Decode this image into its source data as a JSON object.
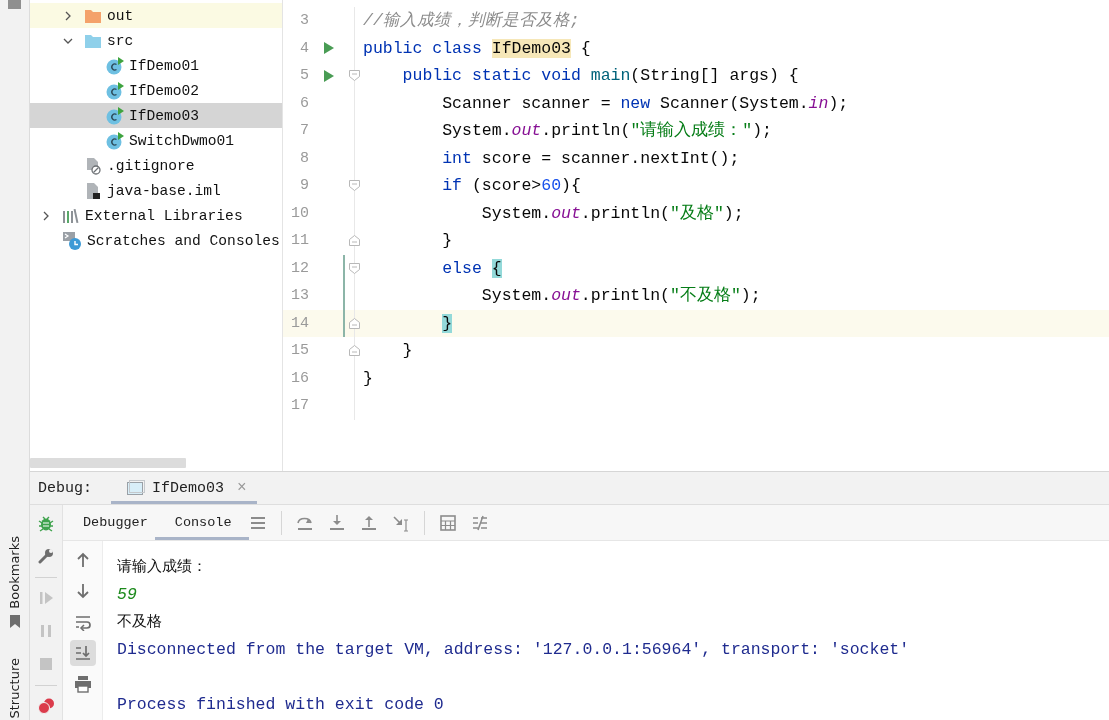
{
  "left_strip": {
    "tools": [
      {
        "label": "Bookmarks"
      },
      {
        "label": "Structure"
      }
    ]
  },
  "project_tree": {
    "items": [
      {
        "kind": "group",
        "children": [
          {
            "label": "out",
            "kind": "folder_excluded",
            "expanded": false,
            "highlighted": true,
            "selected": false
          },
          {
            "label": "src",
            "kind": "folder_source",
            "expanded": true,
            "highlighted": false,
            "selected": false,
            "children": [
              {
                "label": "IfDemo01",
                "kind": "java_class",
                "highlighted": false,
                "selected": false
              },
              {
                "label": "IfDemo02",
                "kind": "java_class",
                "highlighted": false,
                "selected": false
              },
              {
                "label": "IfDemo03",
                "kind": "java_class",
                "highlighted": false,
                "selected": true
              },
              {
                "label": "SwitchDwmo01",
                "kind": "java_class",
                "highlighted": false,
                "selected": false
              }
            ]
          },
          {
            "label": ".gitignore",
            "kind": "ignore_file",
            "highlighted": false,
            "selected": false
          },
          {
            "label": "java-base.iml",
            "kind": "module_file",
            "highlighted": false,
            "selected": false
          }
        ]
      },
      {
        "label": "External Libraries",
        "kind": "libraries",
        "expanded": false,
        "highlighted": false,
        "selected": false
      },
      {
        "label": "Scratches and Consoles",
        "kind": "scratches",
        "highlighted": false,
        "selected": false
      }
    ]
  },
  "editor": {
    "lines": [
      {
        "number": "3",
        "run": false,
        "fold_start": false,
        "fold_end": false,
        "changed": false,
        "current": false,
        "tokens": [
          {
            "kind": "comment",
            "text": "//输入成绩，判断是否及格;"
          }
        ]
      },
      {
        "number": "4",
        "run": true,
        "fold_start": false,
        "fold_end": false,
        "changed": false,
        "current": false,
        "tokens": [
          {
            "kind": "keyword",
            "text": "public class "
          },
          {
            "kind": "usage_highlight",
            "text": "IfDemo03"
          },
          {
            "kind": "text",
            "text": " {"
          }
        ]
      },
      {
        "number": "5",
        "run": true,
        "fold_start": true,
        "fold_end": false,
        "changed": false,
        "current": false,
        "tokens": [
          {
            "kind": "keyword",
            "text": "    public static void "
          },
          {
            "kind": "declaration",
            "text": "main"
          },
          {
            "kind": "text",
            "text": "(String[] args) {"
          }
        ]
      },
      {
        "number": "6",
        "run": false,
        "fold_start": false,
        "fold_end": false,
        "changed": false,
        "current": false,
        "tokens": [
          {
            "kind": "text",
            "text": "        Scanner scanner = "
          },
          {
            "kind": "keyword",
            "text": "new"
          },
          {
            "kind": "text",
            "text": " Scanner(System."
          },
          {
            "kind": "static_field",
            "text": "in"
          },
          {
            "kind": "text",
            "text": ");"
          }
        ]
      },
      {
        "number": "7",
        "run": false,
        "fold_start": false,
        "fold_end": false,
        "changed": false,
        "current": false,
        "tokens": [
          {
            "kind": "text",
            "text": "        System."
          },
          {
            "kind": "static_field",
            "text": "out"
          },
          {
            "kind": "text",
            "text": ".println("
          },
          {
            "kind": "string",
            "text": "\"请输入成绩：\""
          },
          {
            "kind": "text",
            "text": ");"
          }
        ]
      },
      {
        "number": "8",
        "run": false,
        "fold_start": false,
        "fold_end": false,
        "changed": false,
        "current": false,
        "tokens": [
          {
            "kind": "keyword",
            "text": "        int"
          },
          {
            "kind": "text",
            "text": " score = scanner.nextInt();"
          }
        ]
      },
      {
        "number": "9",
        "run": false,
        "fold_start": true,
        "fold_end": false,
        "changed": false,
        "current": false,
        "tokens": [
          {
            "kind": "keyword",
            "text": "        if"
          },
          {
            "kind": "text",
            "text": " (score>"
          },
          {
            "kind": "number",
            "text": "60"
          },
          {
            "kind": "text",
            "text": "){"
          }
        ]
      },
      {
        "number": "10",
        "run": false,
        "fold_start": false,
        "fold_end": false,
        "changed": false,
        "current": false,
        "tokens": [
          {
            "kind": "text",
            "text": "            System."
          },
          {
            "kind": "static_field",
            "text": "out"
          },
          {
            "kind": "text",
            "text": ".println("
          },
          {
            "kind": "string",
            "text": "\"及格\""
          },
          {
            "kind": "text",
            "text": ");"
          }
        ]
      },
      {
        "number": "11",
        "run": false,
        "fold_start": false,
        "fold_end": true,
        "changed": false,
        "current": false,
        "tokens": [
          {
            "kind": "text",
            "text": "        }"
          }
        ]
      },
      {
        "number": "12",
        "run": false,
        "fold_start": true,
        "fold_end": false,
        "changed": true,
        "current": false,
        "tokens": [
          {
            "kind": "keyword",
            "text": "        else "
          },
          {
            "kind": "brace_match",
            "text": "{"
          }
        ]
      },
      {
        "number": "13",
        "run": false,
        "fold_start": false,
        "fold_end": false,
        "changed": true,
        "current": false,
        "tokens": [
          {
            "kind": "text",
            "text": "            System."
          },
          {
            "kind": "static_field",
            "text": "out"
          },
          {
            "kind": "text",
            "text": ".println("
          },
          {
            "kind": "string",
            "text": "\"不及格\""
          },
          {
            "kind": "text",
            "text": ");"
          }
        ]
      },
      {
        "number": "14",
        "run": false,
        "fold_start": false,
        "fold_end": true,
        "changed": true,
        "current": true,
        "tokens": [
          {
            "kind": "brace_match",
            "text": "        }"
          }
        ]
      },
      {
        "number": "15",
        "run": false,
        "fold_start": false,
        "fold_end": true,
        "changed": false,
        "current": false,
        "tokens": [
          {
            "kind": "text",
            "text": "    }"
          }
        ]
      },
      {
        "number": "16",
        "run": false,
        "fold_start": false,
        "fold_end": false,
        "changed": false,
        "current": false,
        "tokens": [
          {
            "kind": "text",
            "text": "}"
          }
        ]
      },
      {
        "number": "17",
        "run": false,
        "fold_start": false,
        "fold_end": false,
        "changed": false,
        "current": false
      }
    ]
  },
  "debug": {
    "title": "Debug:",
    "session_tab": {
      "label": "IfDemo03",
      "close": "×"
    },
    "tabs": [
      {
        "label": "Debugger",
        "selected": false
      },
      {
        "label": "Console",
        "selected": true
      }
    ],
    "toolbar": [
      {
        "kind": "menu"
      },
      {
        "kind": "separator"
      },
      {
        "kind": "step_over"
      },
      {
        "kind": "step_into"
      },
      {
        "kind": "step_out"
      },
      {
        "kind": "run_to_cursor"
      },
      {
        "kind": "separator"
      },
      {
        "kind": "evaluate"
      },
      {
        "kind": "trace"
      }
    ],
    "actions": [
      {
        "kind": "debug",
        "disabled": false
      },
      {
        "kind": "settings",
        "disabled": false
      },
      {
        "kind": "separator"
      },
      {
        "kind": "resume",
        "disabled": true
      },
      {
        "kind": "pause",
        "disabled": true
      },
      {
        "kind": "stop",
        "disabled": true
      },
      {
        "kind": "separator"
      },
      {
        "kind": "breakpoints",
        "disabled": false
      }
    ],
    "console_tools": [
      {
        "kind": "up",
        "selected": false
      },
      {
        "kind": "down",
        "selected": false
      },
      {
        "kind": "wrap",
        "selected": false
      },
      {
        "kind": "scroll_end",
        "selected": true
      },
      {
        "kind": "print",
        "selected": false
      }
    ],
    "console": [
      {
        "kind": "output",
        "text": "请输入成绩："
      },
      {
        "kind": "input",
        "text": "59"
      },
      {
        "kind": "output",
        "text": "不及格"
      },
      {
        "kind": "system",
        "text": "Disconnected from the target VM, address: '127.0.0.1:56964', transport: 'socket'"
      },
      {
        "kind": "blank"
      },
      {
        "kind": "system",
        "text": "Process finished with exit code 0"
      }
    ]
  }
}
